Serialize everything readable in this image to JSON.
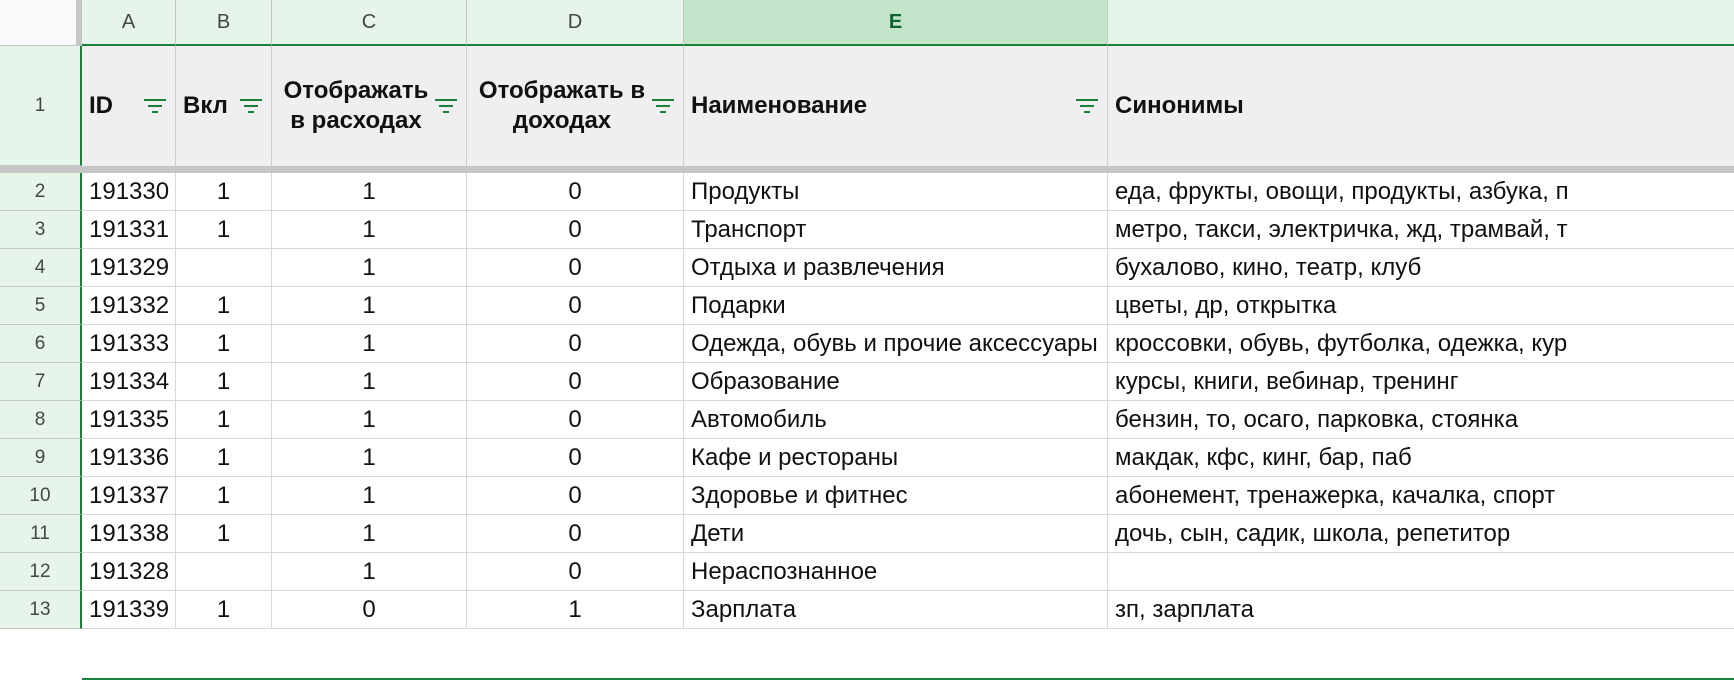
{
  "columns": [
    {
      "letter": "A",
      "active": false
    },
    {
      "letter": "B",
      "active": false
    },
    {
      "letter": "C",
      "active": false
    },
    {
      "letter": "D",
      "active": false
    },
    {
      "letter": "E",
      "active": true
    },
    {
      "letter": "",
      "active": false
    }
  ],
  "header_row": {
    "number": "1",
    "cells": [
      {
        "text": "ID",
        "filter": true,
        "centered": false
      },
      {
        "text": "Вкл",
        "filter": true,
        "centered": false
      },
      {
        "text": "Отображать в расходах",
        "filter": true,
        "centered": true
      },
      {
        "text": "Отображать в доходах",
        "filter": true,
        "centered": true
      },
      {
        "text": "Наименование",
        "filter": true,
        "centered": false
      },
      {
        "text": "Синонимы",
        "filter": false,
        "centered": false
      }
    ]
  },
  "rows": [
    {
      "number": "2",
      "id": "191330",
      "on": "1",
      "expense": "1",
      "income": "0",
      "name": "Продукты",
      "synonyms": "еда, фрукты, овощи, продукты, азбука, п"
    },
    {
      "number": "3",
      "id": "191331",
      "on": "1",
      "expense": "1",
      "income": "0",
      "name": "Транспорт",
      "synonyms": "метро, такси, электричка, жд, трамвай, т"
    },
    {
      "number": "4",
      "id": "191329",
      "on": "",
      "expense": "1",
      "income": "0",
      "name": "Отдыха и развлечения",
      "synonyms": "бухалово, кино, театр, клуб"
    },
    {
      "number": "5",
      "id": "191332",
      "on": "1",
      "expense": "1",
      "income": "0",
      "name": "Подарки",
      "synonyms": "цветы, др, открытка"
    },
    {
      "number": "6",
      "id": "191333",
      "on": "1",
      "expense": "1",
      "income": "0",
      "name": "Одежда, обувь и прочие аксессуары",
      "synonyms": "кроссовки, обувь, футболка, одежка, кур"
    },
    {
      "number": "7",
      "id": "191334",
      "on": "1",
      "expense": "1",
      "income": "0",
      "name": "Образование",
      "synonyms": "курсы, книги, вебинар, тренинг"
    },
    {
      "number": "8",
      "id": "191335",
      "on": "1",
      "expense": "1",
      "income": "0",
      "name": "Автомобиль",
      "synonyms": "бензин, то, осаго, парковка, стоянка"
    },
    {
      "number": "9",
      "id": "191336",
      "on": "1",
      "expense": "1",
      "income": "0",
      "name": "Кафе и рестораны",
      "synonyms": "макдак, кфс, кинг, бар, паб"
    },
    {
      "number": "10",
      "id": "191337",
      "on": "1",
      "expense": "1",
      "income": "0",
      "name": "Здоровье и фитнес",
      "synonyms": "абонемент, тренажерка, качалка, спорт"
    },
    {
      "number": "11",
      "id": "191338",
      "on": "1",
      "expense": "1",
      "income": "0",
      "name": "Дети",
      "synonyms": "дочь, сын, садик, школа, репетитор"
    },
    {
      "number": "12",
      "id": "191328",
      "on": "",
      "expense": "1",
      "income": "0",
      "name": "Нераспознанное",
      "synonyms": ""
    },
    {
      "number": "13",
      "id": "191339",
      "on": "1",
      "expense": "0",
      "income": "1",
      "name": "Зарплата",
      "synonyms": "зп, зарплата"
    }
  ],
  "colors": {
    "column_header_bg": "#e6f4ea",
    "active_column_bg": "#c3e6cb",
    "accent_green": "#188038",
    "header_row_bg": "#efefef",
    "filter_icon": "#188038"
  },
  "icons": {
    "filter": "filter-icon"
  }
}
